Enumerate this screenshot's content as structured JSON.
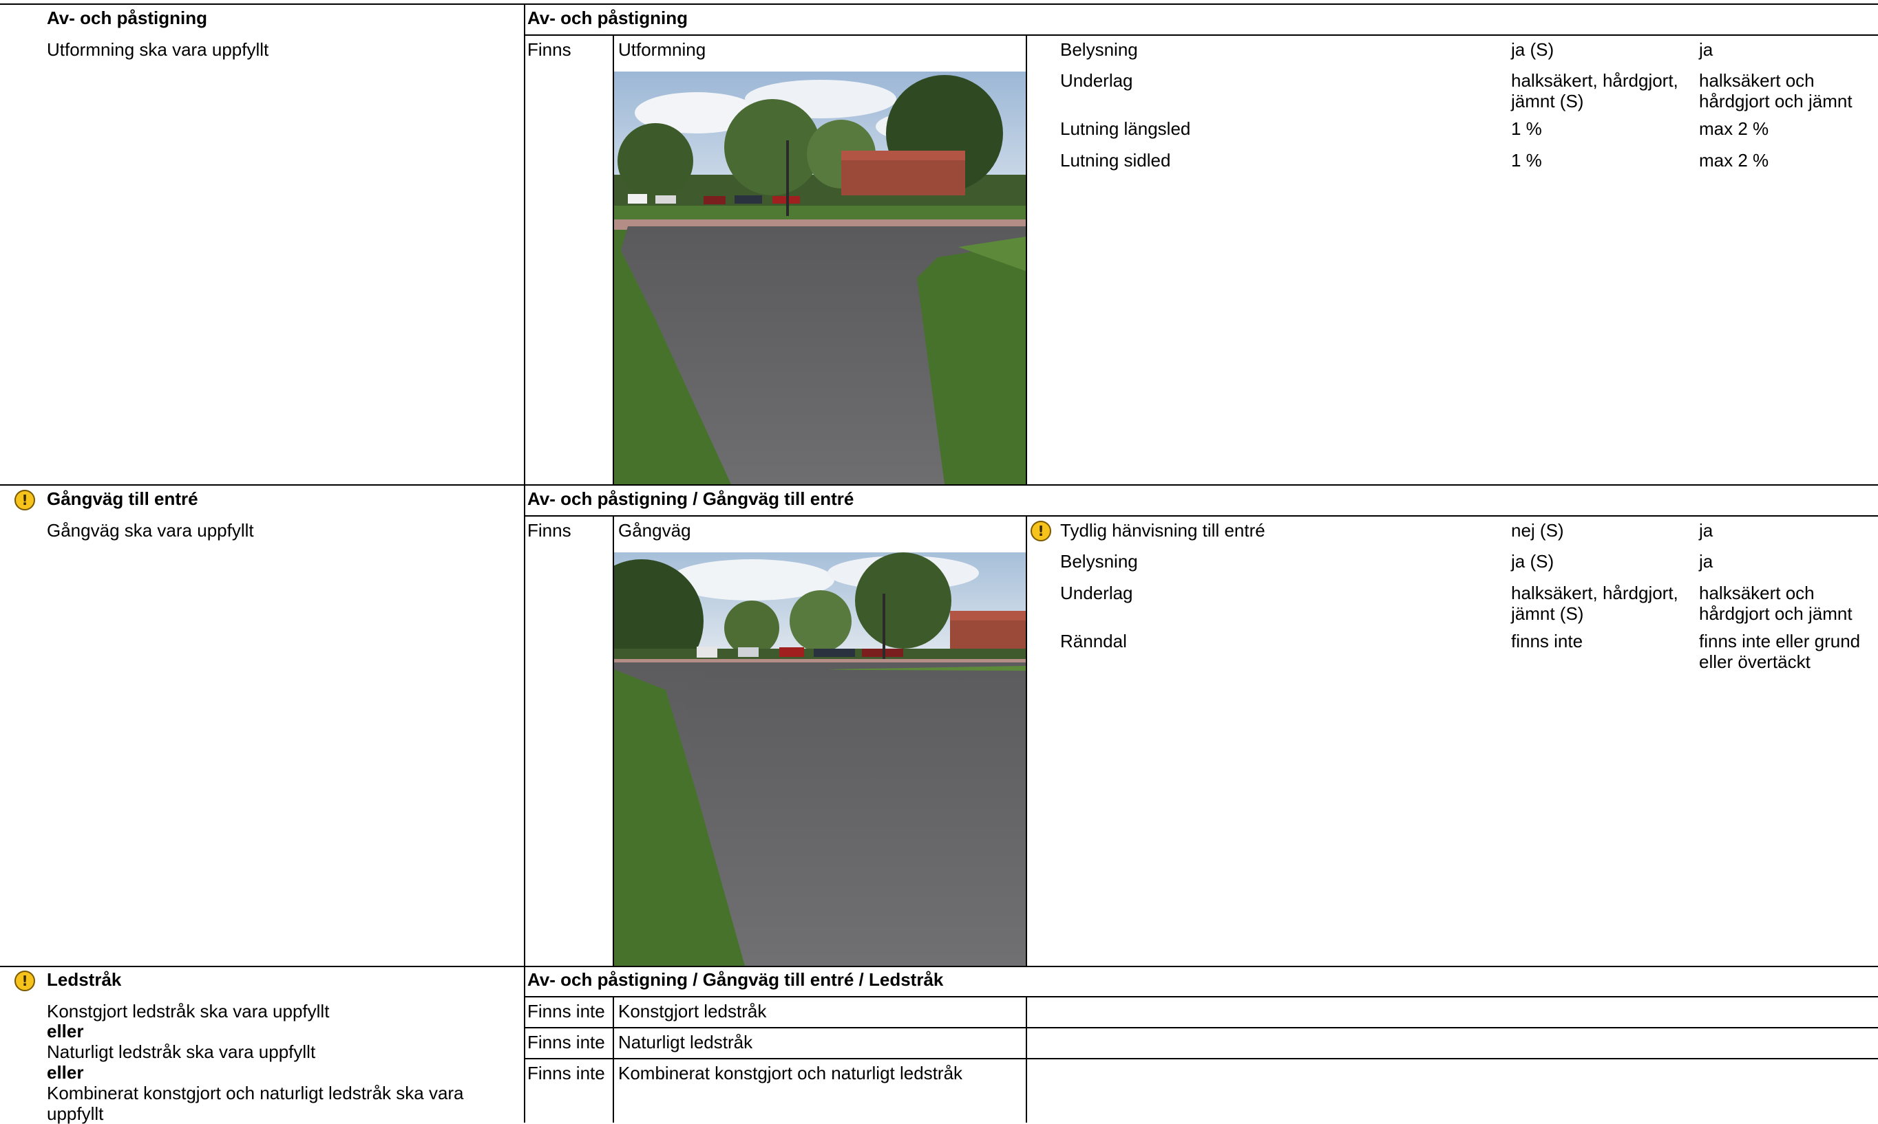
{
  "sections": [
    {
      "left_title": "Av- och påstigning",
      "left_desc": "Utformning ska vara uppfyllt",
      "path_title": "Av- och påstigning",
      "status": "Finns",
      "item": "Utformning",
      "properties": [
        {
          "name": "Belysning",
          "value": "ja (S)",
          "req": "ja"
        },
        {
          "name": "Underlag",
          "value": "halksäkert, hårdgjort, jämnt (S)",
          "req": "halksäkert och hårdgjort och jämnt"
        },
        {
          "name": "Lutning längsled",
          "value": "1 %",
          "req": "max 2 %"
        },
        {
          "name": "Lutning sidled",
          "value": "1 %",
          "req": "max 2 %"
        }
      ]
    },
    {
      "left_title": "Gångväg till entré",
      "left_desc": "Gångväg ska vara uppfyllt",
      "path_title": "Av- och påstigning / Gångväg till entré",
      "status": "Finns",
      "item": "Gångväg",
      "properties": [
        {
          "name": "Tydlig hänvisning till entré",
          "value": "nej (S)",
          "req": "ja"
        },
        {
          "name": "Belysning",
          "value": "ja (S)",
          "req": "ja"
        },
        {
          "name": "Underlag",
          "value": "halksäkert, hårdgjort, jämnt (S)",
          "req": "halksäkert och hårdgjort och jämnt"
        },
        {
          "name": "Ränndal",
          "value": "finns inte",
          "req": "finns inte eller grund eller övertäckt"
        }
      ]
    },
    {
      "left_title": "Ledstråk",
      "left_lines": [
        {
          "text": "Konstgjort ledstråk ska vara uppfyllt"
        },
        {
          "text": "eller"
        },
        {
          "text": "Naturligt ledstråk ska vara uppfyllt"
        },
        {
          "text": "eller"
        },
        {
          "text": "Kombinerat konstgjort och naturligt ledstråk ska vara uppfyllt"
        }
      ],
      "path_title": "Av- och påstigning / Gångväg till entré / Ledstråk",
      "rows": [
        {
          "status": "Finns inte",
          "item": "Konstgjort ledstråk"
        },
        {
          "status": "Finns inte",
          "item": "Naturligt ledstråk"
        },
        {
          "status": "Finns inte",
          "item": "Kombinerat konstgjort och naturligt ledstråk"
        }
      ]
    }
  ],
  "warning_glyph": "!",
  "colors": {
    "warning": "#f6c21c",
    "grid": "#000000"
  }
}
